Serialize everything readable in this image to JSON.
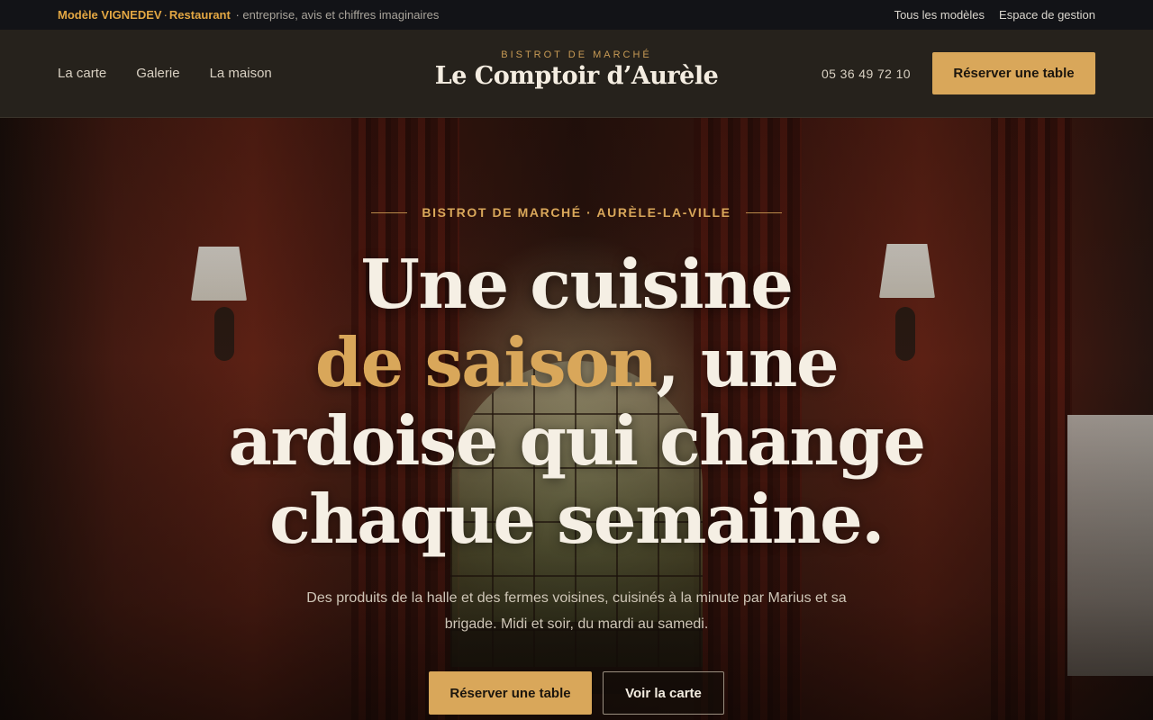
{
  "topbar": {
    "brand": "Modèle VIGNEDEV",
    "separator": "·",
    "category": "Restaurant",
    "tagline": "· entreprise, avis et chiffres imaginaires",
    "links": [
      "Tous les modèles",
      "Espace de gestion"
    ]
  },
  "header": {
    "nav": [
      "La carte",
      "Galerie",
      "La maison"
    ],
    "logo_kicker": "BISTROT DE MARCHÉ",
    "logo_name": "Le Comptoir d’Aurèle",
    "phone": "05 36 49 72 10",
    "reserve_label": "Réserver une table"
  },
  "hero": {
    "eyebrow": "BISTROT DE MARCHÉ · AURÈLE-LA-VILLE",
    "headline_line1": "Une cuisine",
    "headline_accent": "de saison",
    "headline_after_accent": ", une",
    "headline_line3": "ardoise qui change",
    "headline_line4": "chaque semaine.",
    "subtitle": "Des produits de la halle et des fermes voisines, cuisinés à la minute par Marius et sa brigade. Midi et soir, du mardi au samedi.",
    "cta_primary": "Réserver une table",
    "cta_secondary": "Voir la carte"
  },
  "colors": {
    "accent": "#d9a75a",
    "topbar_bg": "#121317",
    "header_bg": "#26221c",
    "text_light": "#f5efe4"
  }
}
